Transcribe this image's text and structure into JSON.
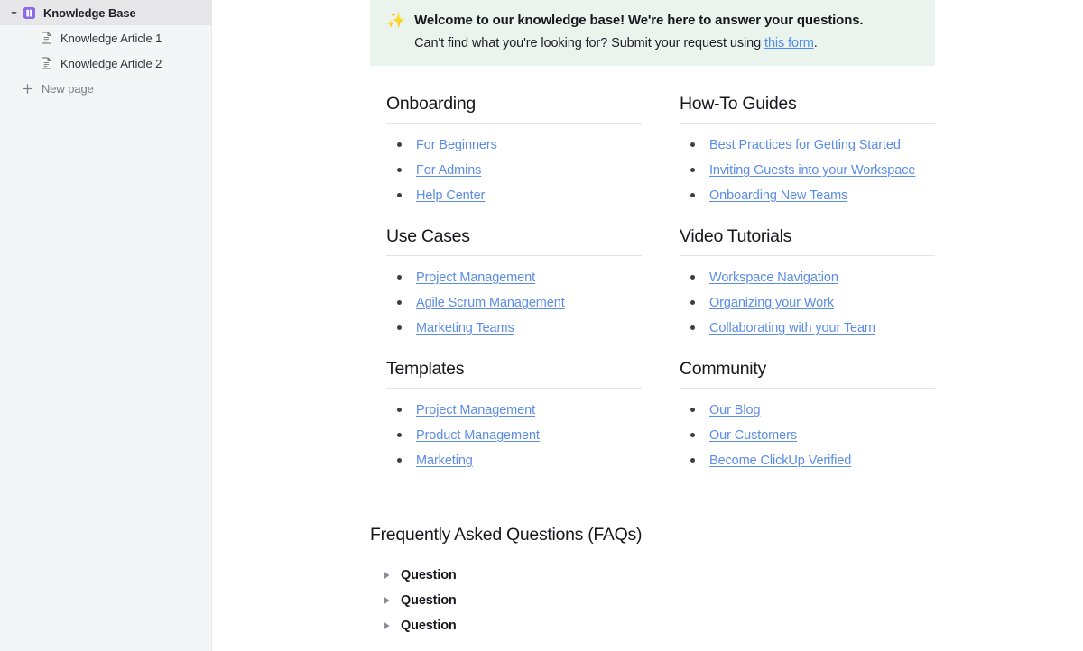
{
  "sidebar": {
    "root": {
      "label": "Knowledge Base",
      "caret_icon": "chevron-down-icon",
      "icon": "book-icon"
    },
    "children": [
      {
        "label": "Knowledge Article 1",
        "icon": "page-icon"
      },
      {
        "label": "Knowledge Article 2",
        "icon": "page-icon"
      }
    ],
    "new_page": {
      "label": "New page",
      "icon": "plus-icon"
    }
  },
  "banner": {
    "emoji": "✨",
    "emoji_name": "sparkles-icon",
    "title": "Welcome to our knowledge base! We're here to answer your questions.",
    "subtitle_before": "Can't find what you're looking for? Submit your request using ",
    "link_text": "this form",
    "subtitle_after": ".",
    "background_color": "#eaf3ec",
    "link_color": "#4f8def"
  },
  "sections": [
    {
      "title": "Onboarding",
      "links": [
        "For Beginners",
        "For Admins",
        "Help Center"
      ]
    },
    {
      "title": "How-To Guides",
      "links": [
        "Best Practices for Getting Started",
        "Inviting Guests into your Workspace",
        "Onboarding New Teams"
      ]
    },
    {
      "title": "Use Cases",
      "links": [
        "Project Management",
        "Agile Scrum Management",
        "Marketing Teams"
      ]
    },
    {
      "title": "Video Tutorials",
      "links": [
        "Workspace Navigation",
        "Organizing your Work",
        "Collaborating with your Team"
      ]
    },
    {
      "title": "Templates",
      "links": [
        "Project Management",
        "Product Management",
        "Marketing"
      ]
    },
    {
      "title": "Community",
      "links": [
        "Our Blog",
        "Our Customers",
        "Become ClickUp Verified"
      ]
    }
  ],
  "faq": {
    "title": "Frequently Asked Questions (FAQs)",
    "items": [
      {
        "label": "Question",
        "toggle_icon": "triangle-right-icon"
      },
      {
        "label": "Question",
        "toggle_icon": "triangle-right-icon"
      },
      {
        "label": "Question",
        "toggle_icon": "triangle-right-icon"
      }
    ]
  },
  "colors": {
    "link": "#5b8ce8",
    "sidebar_bg": "#f4f5f7",
    "sidebar_selected_bg": "#e7e7e9",
    "book_icon": "#8a6ae8",
    "rule": "#e3e3e7"
  }
}
